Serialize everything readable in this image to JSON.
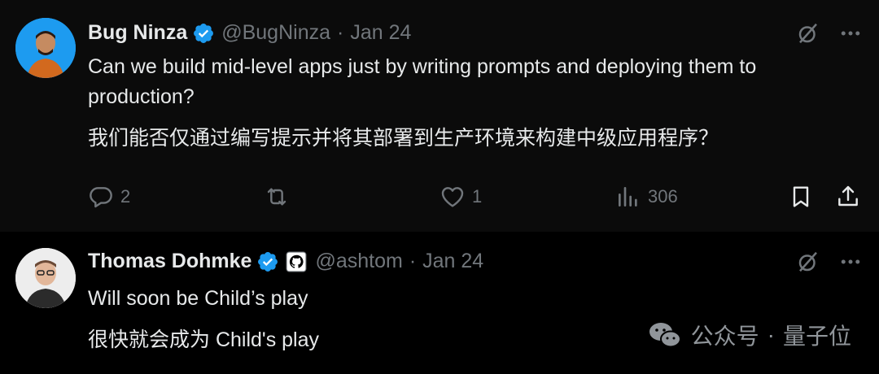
{
  "tweets": [
    {
      "author_name": "Bug Ninza",
      "handle": "@BugNinza",
      "separator": "·",
      "date": "Jan 24",
      "text_en": "Can we build mid-level apps just by writing prompts and deploying them to production?",
      "text_zh": "我们能否仅通过编写提示并将其部署到生产环境来构建中级应用程序？",
      "replies": "2",
      "likes": "1",
      "views": "306"
    },
    {
      "author_name": "Thomas Dohmke",
      "handle": "@ashtom",
      "separator": "·",
      "date": "Jan 24",
      "text_en": "Will soon be Child’s play",
      "text_zh": "很快就会成为 Child's play"
    }
  ],
  "watermark": {
    "channel": "公众号",
    "dot": "·",
    "name": "量子位"
  },
  "colors": {
    "verified": "#1d9bf0",
    "muted": "#71767b",
    "text": "#e7e9ea",
    "background": "#000000"
  }
}
